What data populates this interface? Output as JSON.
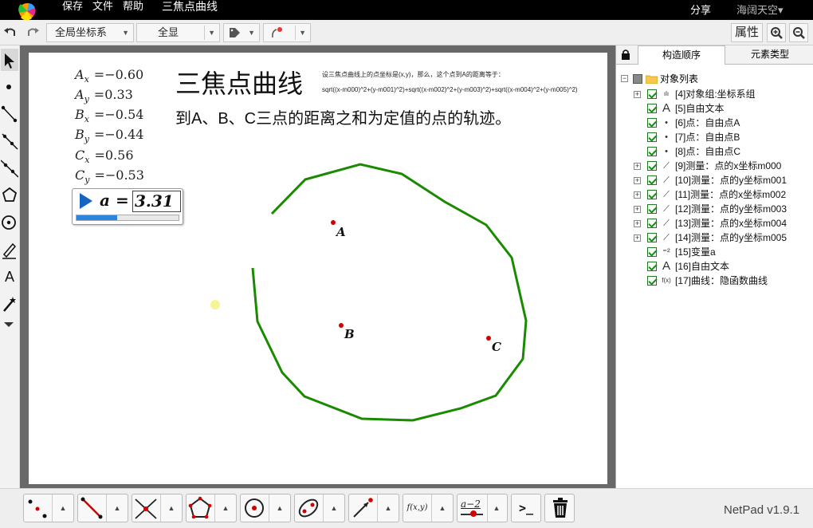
{
  "topbar": {
    "menu": [
      "保存",
      "文件",
      "帮助"
    ],
    "doc_title": "三焦点曲线",
    "share": "分享",
    "user": "海阔天空",
    "user_arrow": "▾"
  },
  "toolbar": {
    "coord_system": "全局坐标系",
    "show_all": "全显",
    "properties": "属性"
  },
  "canvas": {
    "title": "三焦点曲线",
    "subtitle": "到A、B、C三点的距离之和为定值的点的轨迹。",
    "note_line1": "设三焦点曲线上的点坐标是(x,y)，那么，这个点到A的距离等于：",
    "note_line2": "sqrt((x-m000)^2+(y-m001)^2)+sqrt((x-m002)^2+(y-m003)^2)+sqrt((x-m004)^2+(y-m005)^2)",
    "measurements": [
      {
        "sym": "A",
        "sub": "x",
        "val": "=−0.60"
      },
      {
        "sym": "A",
        "sub": "y",
        "val": "=0.33"
      },
      {
        "sym": "B",
        "sub": "x",
        "val": "=−0.54"
      },
      {
        "sym": "B",
        "sub": "y",
        "val": "=−0.44"
      },
      {
        "sym": "C",
        "sub": "x",
        "val": "=0.56"
      },
      {
        "sym": "C",
        "sub": "y",
        "val": "=−0.53"
      }
    ],
    "slider": {
      "name": "a",
      "eq": "=",
      "value": "3.31",
      "fill_fraction": 0.4
    },
    "points": [
      {
        "label": "A",
        "color": "#d40000"
      },
      {
        "label": "B",
        "color": "#d40000"
      },
      {
        "label": "C",
        "color": "#d40000"
      }
    ],
    "curve_color": "#1a8a00"
  },
  "panel": {
    "tabs": [
      "构造顺序",
      "元素类型"
    ],
    "root": "对象列表",
    "items": [
      {
        "text": "[4]对象组:坐标系组",
        "icon": "bar-chart-icon",
        "glyph": "ılı",
        "expand": true,
        "check": true
      },
      {
        "text": "[5]自由文本",
        "icon": "text-icon",
        "glyph": "A",
        "expand": false,
        "check": true
      },
      {
        "text": "[6]点：自由点A",
        "icon": "point-icon",
        "glyph": "•",
        "expand": false,
        "check": true
      },
      {
        "text": "[7]点：自由点B",
        "icon": "point-icon",
        "glyph": "•",
        "expand": false,
        "check": true
      },
      {
        "text": "[8]点：自由点C",
        "icon": "point-icon",
        "glyph": "•",
        "expand": false,
        "check": true
      },
      {
        "text": "[9]测量：点的x坐标m000",
        "icon": "measure-icon",
        "glyph": "⟋",
        "expand": true,
        "check": true
      },
      {
        "text": "[10]测量：点的y坐标m001",
        "icon": "measure-icon",
        "glyph": "⟋",
        "expand": true,
        "check": true
      },
      {
        "text": "[11]测量：点的x坐标m002",
        "icon": "measure-icon",
        "glyph": "⟋",
        "expand": true,
        "check": true
      },
      {
        "text": "[12]测量：点的y坐标m003",
        "icon": "measure-icon",
        "glyph": "⟋",
        "expand": true,
        "check": true
      },
      {
        "text": "[13]测量：点的x坐标m004",
        "icon": "measure-icon",
        "glyph": "⟋",
        "expand": true,
        "check": true
      },
      {
        "text": "[14]测量：点的y坐标m005",
        "icon": "measure-icon",
        "glyph": "⟋",
        "expand": true,
        "check": true
      },
      {
        "text": "[15]变量a",
        "icon": "variable-icon",
        "glyph": "⁼²",
        "expand": false,
        "check": true
      },
      {
        "text": "[16]自由文本",
        "icon": "text-icon",
        "glyph": "A",
        "expand": false,
        "check": true
      },
      {
        "text": "[17]曲线：隐函数曲线",
        "icon": "function-icon",
        "glyph": "f(x)",
        "expand": false,
        "check": true
      }
    ]
  },
  "bottombar": {
    "function_label": "f(x,y)",
    "a2_label": "a−2",
    "prompt_label": ">_",
    "version": "NetPad v1.9.1"
  }
}
